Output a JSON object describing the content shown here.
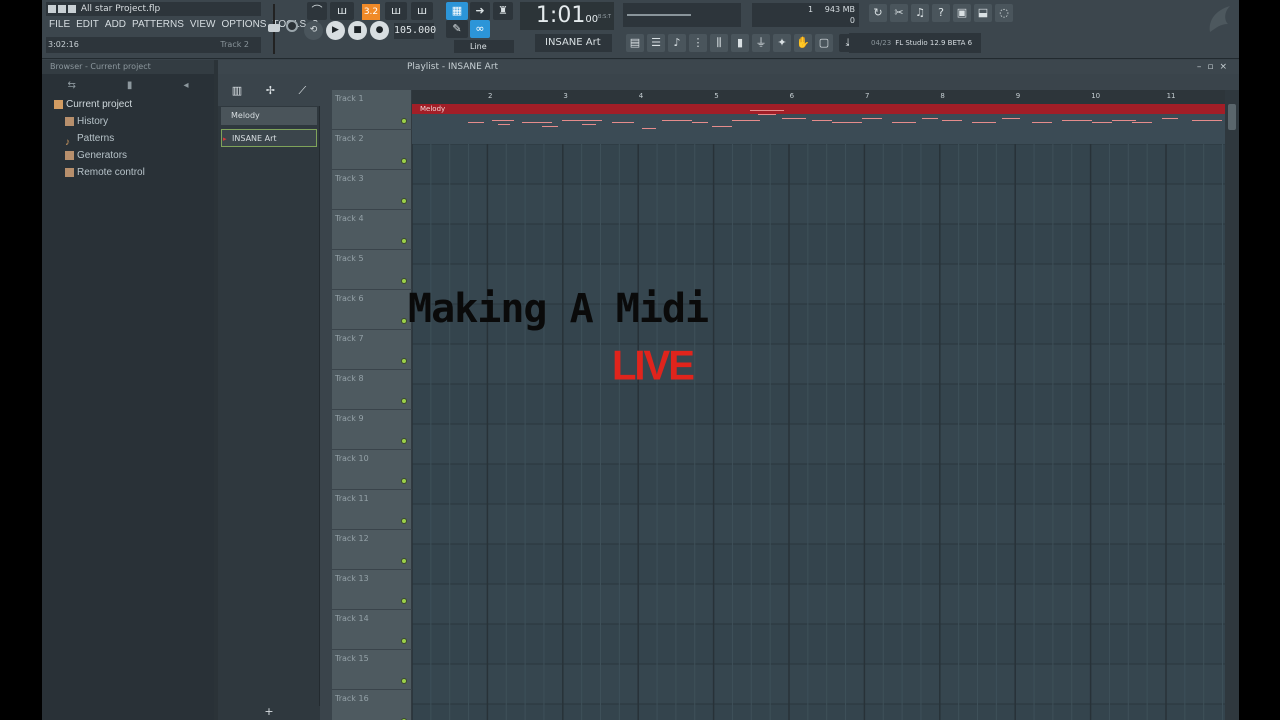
{
  "window": {
    "project_title": "All star Project.flp",
    "hint_time": "3:02:16",
    "hint_track": "Track 2"
  },
  "menu": [
    "FILE",
    "EDIT",
    "ADD",
    "PATTERNS",
    "VIEW",
    "OPTIONS",
    "TOOLS",
    "?"
  ],
  "toolbar": {
    "pattern_mode": "3.2",
    "tempo": "105.000",
    "time_main": "1:01",
    "time_sub": "00",
    "time_unit": "B:S:T",
    "snap": "Line",
    "pattern_select": "INSANE Art",
    "poly_count": "1",
    "ram": "943 MB",
    "voices": "0",
    "news_date": "04/23",
    "news_text": "FL Studio 12.9 BETA 6"
  },
  "browser": {
    "header": "Browser - Current project",
    "root": "Current project",
    "items": [
      "History",
      "Patterns",
      "Generators",
      "Remote control"
    ]
  },
  "playlist": {
    "title": "Playlist - INSANE Art",
    "picker": [
      "Melody",
      "INSANE Art"
    ],
    "tracks": [
      "Track 1",
      "Track 2",
      "Track 3",
      "Track 4",
      "Track 5",
      "Track 6",
      "Track 7",
      "Track 8",
      "Track 9",
      "Track 10",
      "Track 11",
      "Track 12",
      "Track 13",
      "Track 14",
      "Track 15",
      "Track 16"
    ],
    "bars": [
      "2",
      "3",
      "4",
      "5",
      "6",
      "7",
      "8",
      "9",
      "10",
      "11"
    ],
    "clip_label": "Melody"
  },
  "overlay": {
    "title": "Making A Midi",
    "live": "LIVE"
  },
  "colors": {
    "accent_blue": "#2c95d8",
    "accent_orange": "#f08a28",
    "clip_red": "#a21e27",
    "live_red": "#e0241c"
  }
}
